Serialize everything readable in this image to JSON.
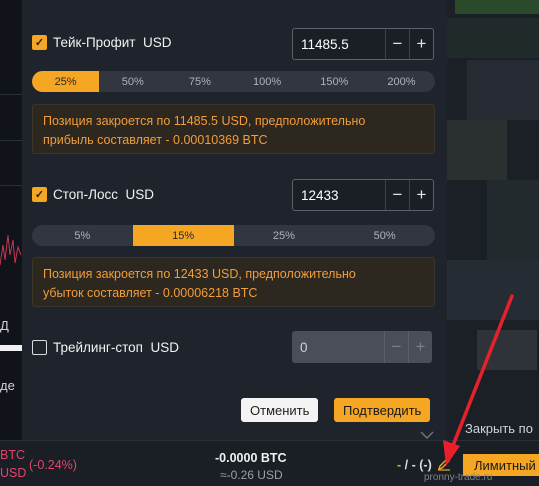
{
  "background": {
    "left_letters": [
      "Д",
      "де"
    ],
    "right_texts": [
      "Закрыть по"
    ]
  },
  "take_profit": {
    "checked": true,
    "label": "Тейк-Профит  USD",
    "value": "11485.5",
    "minus": "−",
    "plus": "+",
    "options": [
      "25%",
      "50%",
      "75%",
      "100%",
      "150%",
      "200%"
    ],
    "selected": "25%",
    "message_line1": "Позиция закроется по 11485.5 USD, предположительно",
    "message_line2": "прибыль составляет - 0.00010369 BTC"
  },
  "stop_loss": {
    "checked": true,
    "label": "Стоп-Лосс  USD",
    "value": "12433",
    "minus": "−",
    "plus": "+",
    "options": [
      "5%",
      "15%",
      "25%",
      "50%"
    ],
    "selected": "15%",
    "message_line1": "Позиция закроется по 12433 USD, предположительно",
    "message_line2": "убыток составляет - 0.00006218 BTC"
  },
  "trailing_stop": {
    "checked": false,
    "label": "Трейлинг-стоп  USD",
    "value": "0",
    "minus": "−",
    "plus": "+"
  },
  "buttons": {
    "cancel": "Отменить",
    "confirm": "Подтвердить"
  },
  "bottom_bar": {
    "left_line1": "BTC",
    "left_line2": "USD",
    "pnl_percent": "(-0.24%)",
    "btc_amount": "-0.0000 BTC",
    "usd_amount": "≈-0.26 USD",
    "tp_sl_a": "-",
    "tp_sl_sep": " / ",
    "tp_sl_b": "-",
    "tp_sl_c": " (-)",
    "limit_button": "Лимитный"
  },
  "watermark": "pronny-trade.ru",
  "colors": {
    "accent": "#f5a623",
    "negative": "#e3436b",
    "arrow": "#e8202b"
  }
}
